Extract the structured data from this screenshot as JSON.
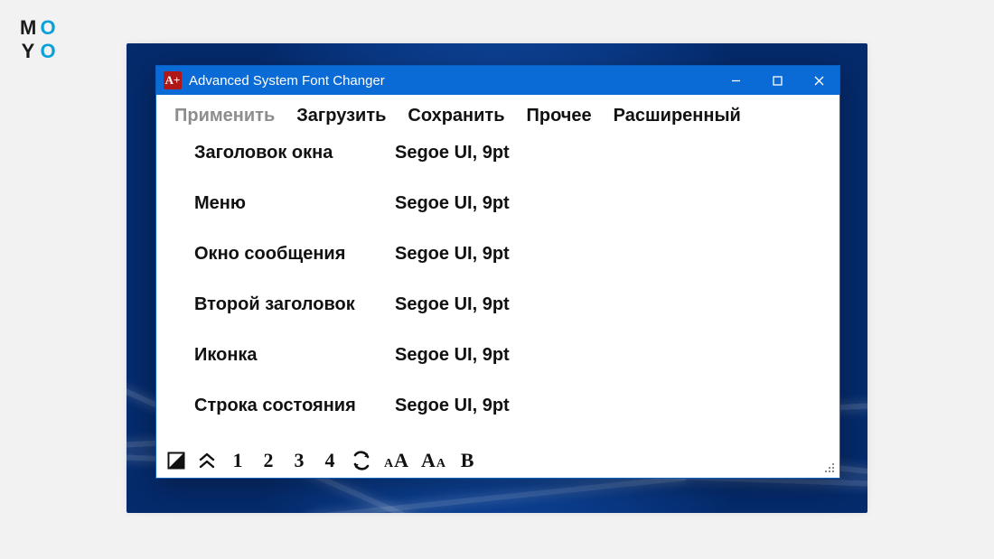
{
  "logo": {
    "l1": "M",
    "l2": "O",
    "l3": "Y",
    "l4": "O"
  },
  "window": {
    "app_icon_text": "A+",
    "title": "Advanced System Font Changer"
  },
  "menu": {
    "apply": "Применить",
    "load": "Загрузить",
    "save": "Сохранить",
    "other": "Прочее",
    "advanced": "Расширенный"
  },
  "rows": [
    {
      "label": "Заголовок окна",
      "value": "Segoe UI, 9pt"
    },
    {
      "label": "Меню",
      "value": "Segoe UI, 9pt"
    },
    {
      "label": "Окно сообщения",
      "value": "Segoe UI, 9pt"
    },
    {
      "label": "Второй заголовок",
      "value": "Segoe UI, 9pt"
    },
    {
      "label": "Иконка",
      "value": "Segoe UI, 9pt"
    },
    {
      "label": "Строка состояния",
      "value": "Segoe UI, 9pt"
    }
  ],
  "toolbar": {
    "n1": "1",
    "n2": "2",
    "n3": "3",
    "n4": "4",
    "aa_small": "A",
    "aa_large": "A",
    "bold": "B"
  }
}
